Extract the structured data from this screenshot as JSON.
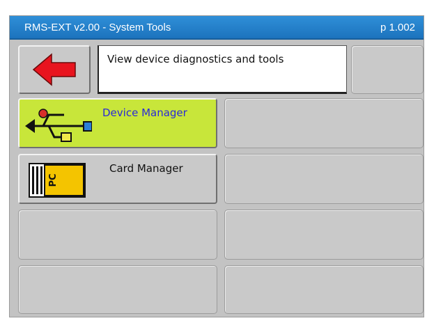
{
  "window": {
    "title": "RMS-EXT v2.00 - System Tools",
    "page": "p 1.002"
  },
  "header": {
    "back_icon": "red-left-arrow-icon",
    "description": "View device diagnostics and tools"
  },
  "menu": [
    {
      "label": "Device Manager",
      "icon": "usb-icon",
      "active": true
    },
    {
      "label": "Card Manager",
      "icon": "pc-card-icon",
      "active": false
    }
  ],
  "colors": {
    "title_bar": "#1f78c4",
    "active_button": "#c8e63a",
    "active_label": "#2a2ad8",
    "back_arrow": "#e8141e"
  }
}
